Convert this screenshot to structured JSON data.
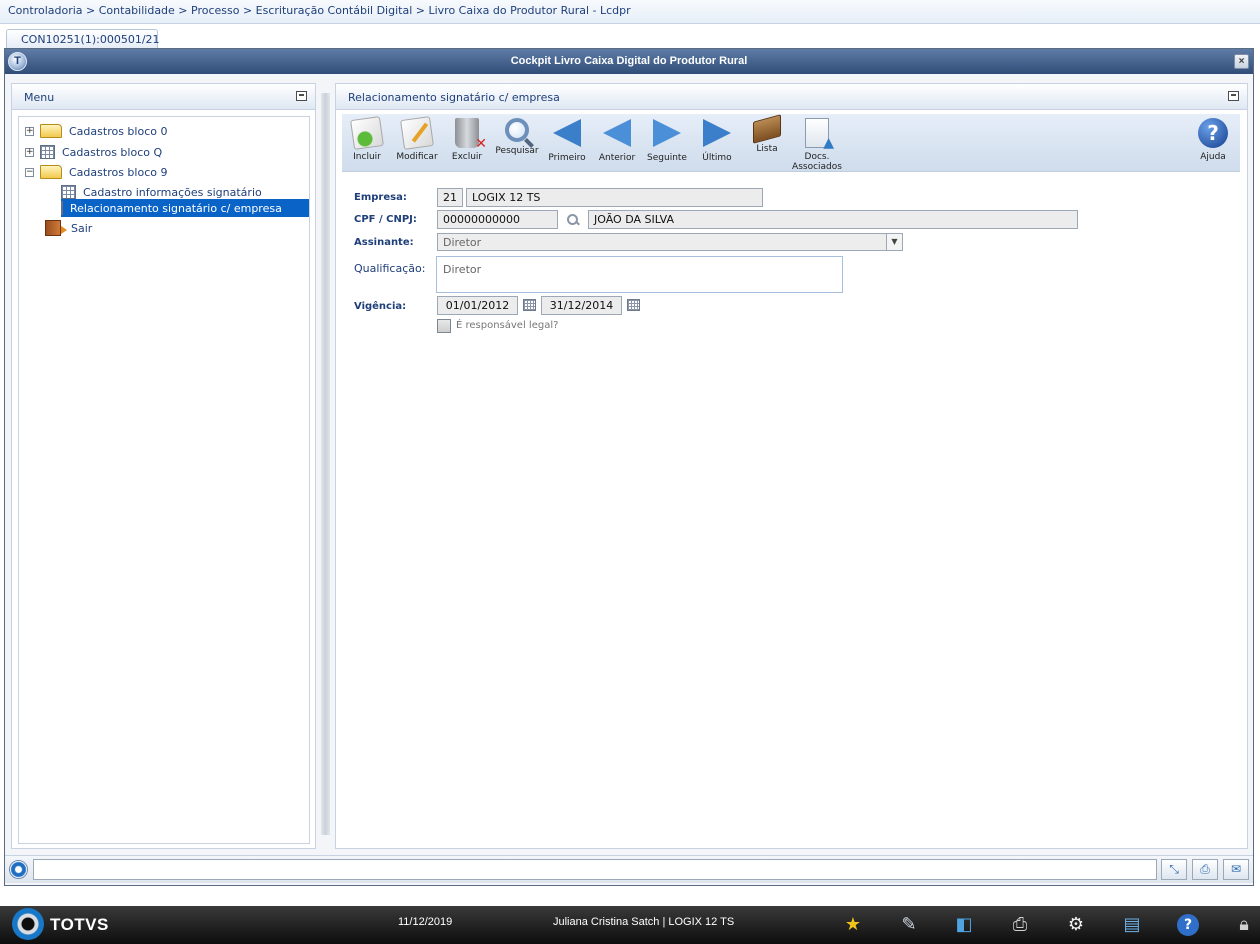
{
  "breadcrumb": "Controladoria > Contabilidade > Processo > Escrituração Contábil Digital > Livro Caixa do Produtor Rural - Lcdpr",
  "tab": {
    "label": "CON10251(1):000501/21"
  },
  "window": {
    "title": "Cockpit Livro Caixa Digital do Produtor Rural",
    "close": "×"
  },
  "menu": {
    "title": "Menu",
    "items": [
      {
        "label": "Cadastros bloco 0",
        "icon": "folder-icon",
        "expander": "+"
      },
      {
        "label": "Cadastros bloco Q",
        "icon": "grid-icon",
        "expander": "+"
      },
      {
        "label": "Cadastros bloco 9",
        "icon": "folder-open-icon",
        "expander": "−"
      },
      {
        "label": "Cadastro informações signatário",
        "icon": "grid-icon"
      },
      {
        "label": "Relacionamento signatário c/ empresa",
        "icon": "grid-icon",
        "selected": true
      },
      {
        "label": "Sair",
        "icon": "exit-door-icon"
      }
    ]
  },
  "content": {
    "title": "Relacionamento signatário c/ empresa",
    "toolbar": {
      "incluir": "Incluir",
      "modificar": "Modificar",
      "excluir": "Excluir",
      "pesquisar": "Pesquisar",
      "primeiro": "Primeiro",
      "anterior": "Anterior",
      "seguinte": "Seguinte",
      "ultimo": "Último",
      "lista": "Lista",
      "docs_line1": "Docs.",
      "docs_line2": "Associados",
      "ajuda": "Ajuda"
    },
    "form": {
      "empresa_label": "Empresa:",
      "empresa_code": "21",
      "empresa_name": "LOGIX 12 TS",
      "cpf_label": "CPF / CNPJ:",
      "cpf_value": "00000000000",
      "cpf_name": "JOÃO DA SILVA",
      "assinante_label": "Assinante:",
      "assinante_value": "Diretor",
      "qualificacao_label": "Qualificação:",
      "qualificacao_value": "Diretor",
      "vigencia_label": "Vigência:",
      "vigencia_start": "01/01/2012",
      "vigencia_end": "31/12/2014",
      "responsavel_label": "É responsável legal?",
      "responsavel_checked": false
    }
  },
  "taskbar": {
    "brand": "TOTVS",
    "date": "11/12/2019",
    "user": "Juliana Cristina Satch | LOGIX 12 TS"
  },
  "colors": {
    "accent": "#1f3f7a",
    "selection": "#0a64c8",
    "titlebar": "#2f4d78"
  }
}
